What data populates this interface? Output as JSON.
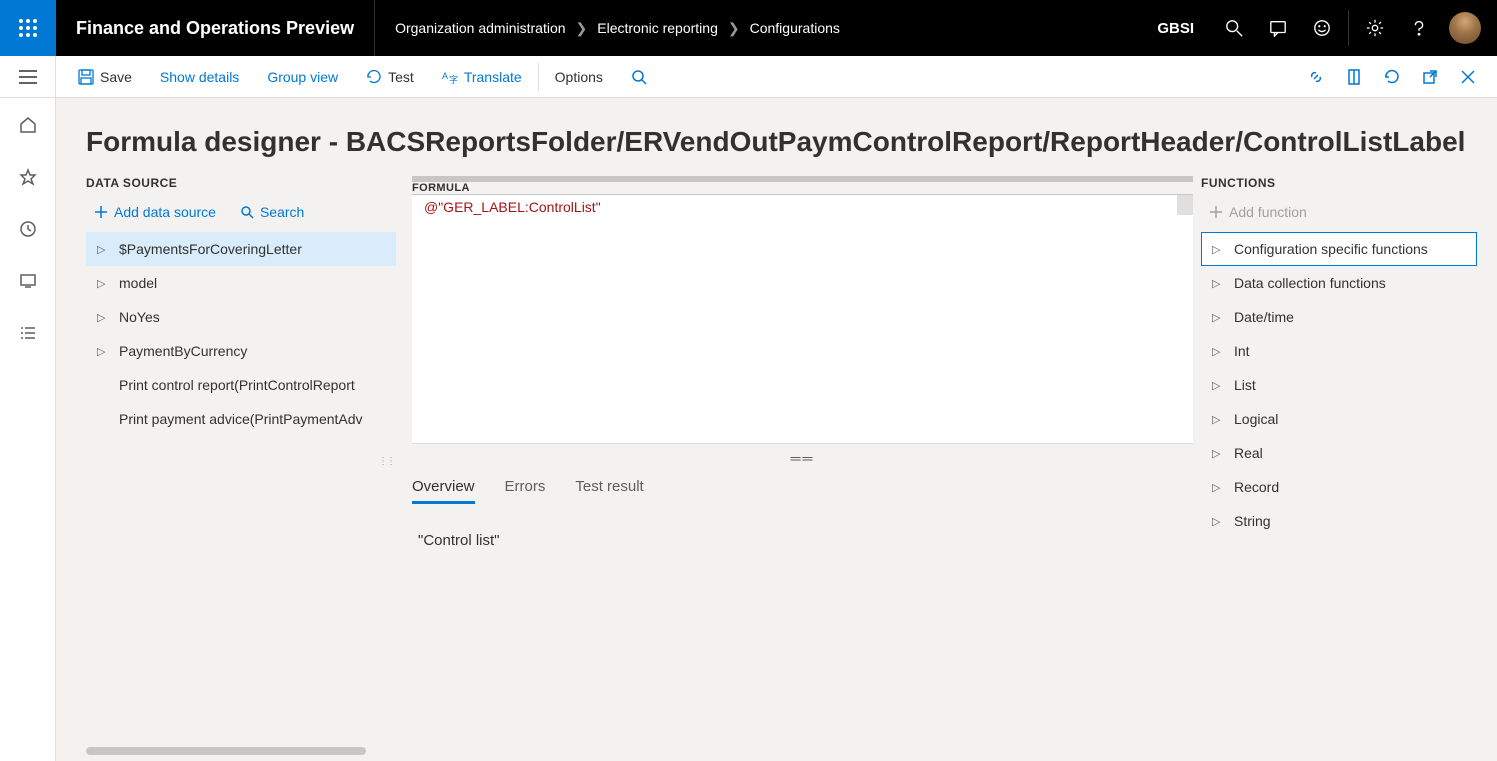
{
  "header": {
    "app_title": "Finance and Operations Preview",
    "breadcrumb": [
      "Organization administration",
      "Electronic reporting",
      "Configurations"
    ],
    "legal_entity": "GBSI"
  },
  "action_bar": {
    "save": "Save",
    "show_details": "Show details",
    "group_view": "Group view",
    "test": "Test",
    "translate": "Translate",
    "options": "Options"
  },
  "page": {
    "title": "Formula designer - BACSReportsFolder/ERVendOutPaymControlReport/ReportHeader/ControlListLabel"
  },
  "data_source": {
    "label": "DATA SOURCE",
    "add": "Add data source",
    "search": "Search",
    "items": [
      {
        "label": "$PaymentsForCoveringLetter",
        "expandable": true,
        "selected": true
      },
      {
        "label": "model",
        "expandable": true
      },
      {
        "label": "NoYes",
        "expandable": true
      },
      {
        "label": "PaymentByCurrency",
        "expandable": true
      },
      {
        "label": "Print control report(PrintControlReport",
        "expandable": false
      },
      {
        "label": "Print payment advice(PrintPaymentAdv",
        "expandable": false
      }
    ]
  },
  "formula": {
    "label": "FORMULA",
    "code": "@\"GER_LABEL:ControlList\""
  },
  "tabs": {
    "overview": "Overview",
    "errors": "Errors",
    "test_result": "Test result",
    "result_value": "\"Control list\""
  },
  "functions": {
    "label": "FUNCTIONS",
    "add": "Add function",
    "items": [
      {
        "label": "Configuration specific functions",
        "boxed": true
      },
      {
        "label": "Data collection functions"
      },
      {
        "label": "Date/time"
      },
      {
        "label": "Int"
      },
      {
        "label": "List"
      },
      {
        "label": "Logical"
      },
      {
        "label": "Real"
      },
      {
        "label": "Record"
      },
      {
        "label": "String"
      }
    ]
  }
}
